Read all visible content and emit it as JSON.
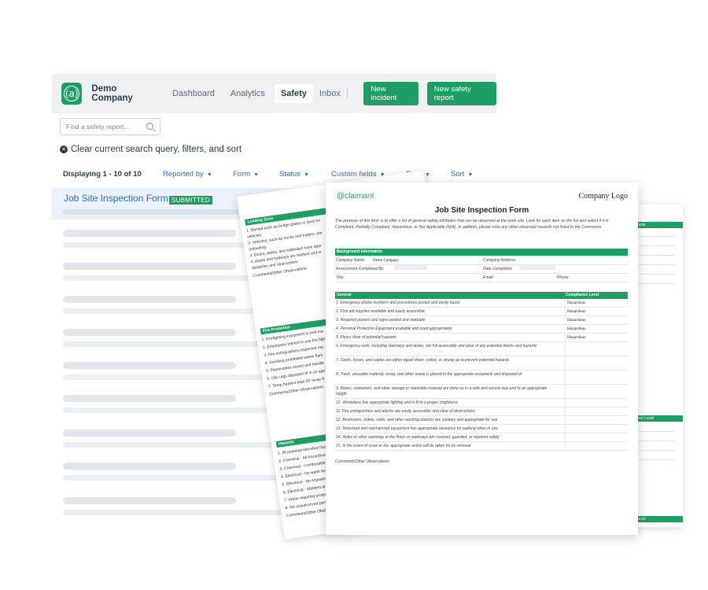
{
  "app": {
    "logo_glyph": "(a)",
    "company": "Demo Company",
    "nav": [
      "Dashboard",
      "Analytics",
      "Safety",
      "Inbox"
    ],
    "buttons": {
      "new_incident": "New incident",
      "new_safety_report": "New safety report"
    },
    "search": {
      "placeholder": "Find a safety report..."
    },
    "clear": "Clear current search query, filters, and sort",
    "count": "Displaying 1 - 10 of 10",
    "filters": [
      "Reported by",
      "Form",
      "Status",
      "Custom fields",
      "Date",
      "Sort"
    ],
    "result": {
      "title": "Job Site Inspection Form",
      "status": "SUBMITTED"
    },
    "accent": "#1f9e63",
    "link_color": "#2d6cc0"
  },
  "doc_back": {
    "sections": [
      {
        "title": "Loading Zone",
        "lines": [
          "1. Ramps such as bridge plates or dock bo",
          "vehicles",
          "2. Vehicles, such as trucks and trailers, are",
          "unloading",
          "3. Doors, aisles, and walkways have appr",
          "4. Aisles and hallways are marked and w",
          "obstacles and obstructions",
          "Comments/Other Observations:"
        ]
      },
      {
        "title": "Fire Protection",
        "lines": [
          "1. Firefighting equipment is well-ma",
          "2. Employees trained to use fire-figh",
          "3. Fire extinguishers inspected mo",
          "4. Smoking prohibited where flam",
          "5. Flammables stored and handle",
          "6. Oily rags disposed of in an app",
          "7. Temp heaters kept 20' away fr",
          "Comments/Other Observations:"
        ]
      },
      {
        "title": "Hazards",
        "lines": [
          "1. All potential identified haz",
          "2. Chemical - All hazardous c",
          "3. Chemical - Combustible c",
          "4. Electrical - No water leak",
          "5. Electrical - No exposed w",
          "6. Electrical - Welders and",
          "7. Areas requiring protect",
          "8. No unauthorized perso",
          "Comments/Other Obse"
        ]
      }
    ]
  },
  "doc_right": {
    "headers": [
      "Complia",
      "pliance Level",
      "ce Level"
    ]
  },
  "doc": {
    "brand": "@claimant",
    "company_logo": "Company Logo",
    "title": "Job Site Inspection Form",
    "intro": "The purpose of this form is to offer a list of general safety attributes that can be observed at the work site. Look for each item on the list and select if it is Compliant, Partially Compliant, Hazardous, or Not Applicable (N/A). In addition, please note any other observed hazards not listed in the Comments.",
    "background": {
      "heading": "Background Information",
      "company_name_label": "Company Name:",
      "company_name_value": "Demo Company",
      "company_address_label": "Company Address:",
      "assessment_label": "Assessment Completed By:",
      "date_label": "Date Completed:",
      "title_label": "Title:",
      "email_label": "Email:",
      "phone_label": "Phone:"
    },
    "general": {
      "heading": "General",
      "compliance_heading": "Compliance Level",
      "rows": [
        {
          "q": "1. Emergency phone numbers and procedures posted and easily found",
          "v": "Hazardous"
        },
        {
          "q": "2. First aid supplies available and easily accessible",
          "v": "Hazardous"
        },
        {
          "q": "3. Required posters and signs posted and readable",
          "v": "Hazardous"
        },
        {
          "q": "4. Personal Protective Equipment available and used appropriately",
          "v": "Hazardous"
        },
        {
          "q": "5. Floors clear of potential hazards",
          "v": "Hazardous"
        },
        {
          "q": "6. Emergency exits, including stairways and aisles, are full accessible and clear of any potential blocks and hazards",
          "v": ""
        },
        {
          "q": "7. Cords, hoses, and cables are either taped down, coiled, or strung up to prevent potential hazards",
          "v": ""
        },
        {
          "q": "8. Trash, unusable material, scrap, and other waste is placed in the appropriate receptacle and disposed of",
          "v": ""
        },
        {
          "q": "9. Boxes, containers, and other storage or stackable material are done so in a safe and secure way and to an appropriate height",
          "v": ""
        },
        {
          "q": "10. Workplace has appropriate lighting and is lit to a proper brightness",
          "v": ""
        },
        {
          "q": "11. Fire extinguishers and alarms are easily accessible and clear of obstructions",
          "v": ""
        },
        {
          "q": "12. Restrooms, toilets, sinks, and other washing stations are sanitary and appropriate for use",
          "v": ""
        },
        {
          "q": "13. Motorized and mechanized equipment has appropriate clearance for walking when in use",
          "v": ""
        },
        {
          "q": "14. Holes or other openings in the floors or walkways are covered, guarded, or repaired safely",
          "v": ""
        },
        {
          "q": "15. In the event of snow or ice, appropriate action will be taken for its removal",
          "v": ""
        }
      ],
      "comments": "Comments/Other Observations:"
    }
  }
}
